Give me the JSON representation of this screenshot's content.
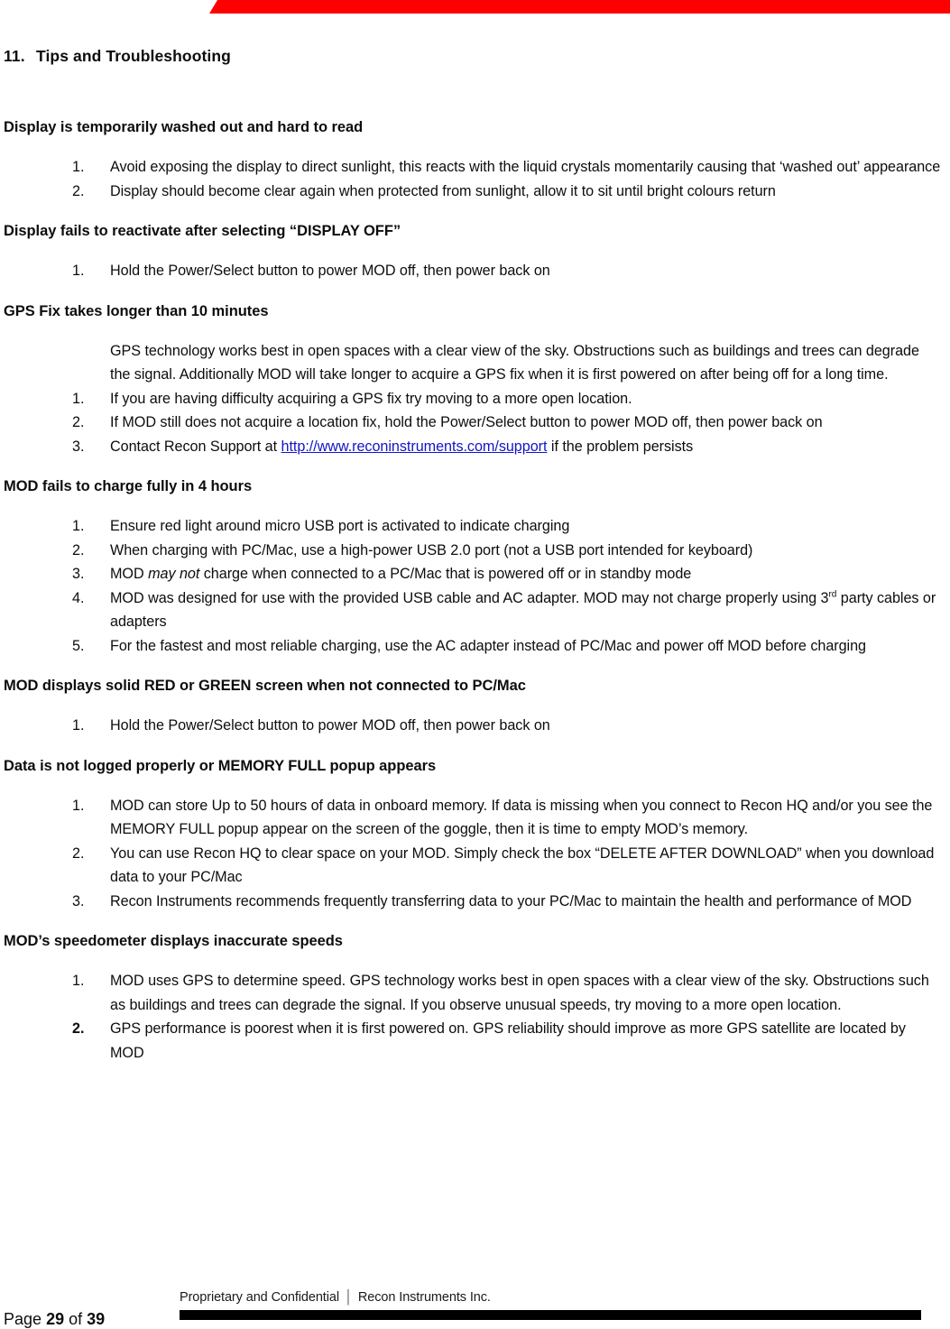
{
  "document": {
    "chapter_number": "11.",
    "chapter_title": "Tips and Troubleshooting",
    "accent_color": "#ff0000",
    "link_color": "#1414c8"
  },
  "sections": [
    {
      "heading": "Display is temporarily washed out and hard to read",
      "items": [
        {
          "marker": "1.",
          "text": "Avoid exposing the display to direct sunlight, this reacts with the liquid crystals momentarily causing that ‘washed out’ appearance"
        },
        {
          "marker": "2.",
          "text": "Display should become clear again when protected from sunlight, allow it to sit until bright colours return"
        }
      ]
    },
    {
      "heading": "Display fails to reactivate after selecting “DISPLAY OFF”",
      "items": [
        {
          "marker": "1.",
          "text": "Hold the Power/Select button to power MOD off, then power back on"
        }
      ]
    },
    {
      "heading": "GPS Fix takes longer than 10 minutes",
      "intro": "GPS technology works best in open spaces with a clear view of the sky. Obstructions such as buildings and trees can degrade the signal. Additionally MOD will take longer to acquire a GPS fix when it is first powered on after being off for a long time.",
      "items": [
        {
          "marker": "1.",
          "text": "If you are having difficulty acquiring a GPS fix try moving to a more open location."
        },
        {
          "marker": "2.",
          "text": "If MOD still does not acquire a location fix, hold the Power/Select button to power MOD off, then power back on"
        },
        {
          "marker": "3.",
          "text_before_link": "Contact Recon Support at ",
          "link_text": "http://www.reconinstruments.com/support",
          "text_after_link": " if the problem persists"
        }
      ]
    },
    {
      "heading": "MOD fails to charge fully in 4 hours",
      "items": [
        {
          "marker": "1.",
          "text": "Ensure red light around micro USB port is activated to indicate charging"
        },
        {
          "marker": "2.",
          "text": "When charging with PC/Mac, use a high-power USB 2.0 port (not a USB port intended for keyboard)"
        },
        {
          "marker": "3.",
          "text_before_italic": "MOD ",
          "italic_text": "may not",
          "text_after_italic": " charge when connected to a PC/Mac that is powered off or in standby mode"
        },
        {
          "marker": "4.",
          "text_before_sup": "MOD was designed for use with the provided USB cable and AC adapter. MOD may not charge properly using 3",
          "sup_text": "rd",
          "text_after_sup": " party cables or adapters"
        },
        {
          "marker": "5.",
          "text": "For the fastest and most reliable charging, use the AC adapter instead of PC/Mac and power off MOD before charging"
        }
      ]
    },
    {
      "heading": "MOD displays solid RED or GREEN screen when not connected to PC/Mac",
      "items": [
        {
          "marker": "1.",
          "text": "Hold the Power/Select button to power MOD off, then power back on"
        }
      ]
    },
    {
      "heading": "Data is not logged properly or MEMORY FULL popup appears",
      "items": [
        {
          "marker": "1.",
          "text": "MOD can store Up to 50 hours of data in onboard memory. If data is missing when you connect to Recon HQ and/or you see the MEMORY FULL popup appear on the screen of the goggle, then it is time to empty MOD’s memory."
        },
        {
          "marker": "2.",
          "text": "You can use Recon HQ to clear space on your MOD. Simply check the box “DELETE AFTER DOWNLOAD” when you download data to your PC/Mac"
        },
        {
          "marker": "3.",
          "text": "Recon Instruments recommends frequently transferring data to your PC/Mac to maintain the health and performance of MOD"
        }
      ]
    },
    {
      "heading": "MOD’s speedometer displays inaccurate speeds",
      "items": [
        {
          "marker": "1.",
          "text": "MOD uses GPS to determine speed. GPS technology works best in open spaces with a clear view of the sky. Obstructions such as buildings and trees can degrade the signal. If you observe unusual speeds, try moving to a more open location."
        },
        {
          "marker": "2.",
          "bold_marker": true,
          "text": "GPS performance is poorest when it is first powered on. GPS reliability should improve as more GPS satellite are located by MOD"
        }
      ]
    }
  ],
  "footer": {
    "confidential_left": "Proprietary and Confidential",
    "divider": "│",
    "confidential_right": "Recon Instruments Inc.",
    "page_prefix": "Page",
    "page_number": "29",
    "page_of": "of",
    "page_total": "39"
  }
}
